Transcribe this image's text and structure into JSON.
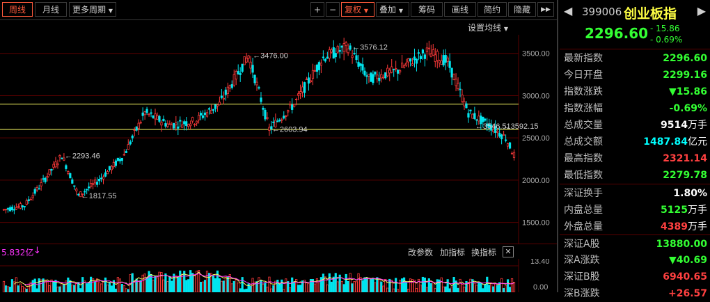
{
  "toolbar": {
    "period_week": "周线",
    "period_month": "月线",
    "period_more": "更多周期",
    "zoom_in": "+",
    "zoom_out": "−",
    "adjust": "复权",
    "overlay": "叠加",
    "chips": "筹码",
    "draw_line": "画线",
    "brief": "简约",
    "hide": "隐藏"
  },
  "chart_settings": {
    "ma_setting": "设置均线"
  },
  "chart_data": {
    "type": "candlestick",
    "y_ticks": [
      "3500.00",
      "3000.00",
      "2500.00",
      "2000.00",
      "1500.00"
    ],
    "ylim": [
      1250,
      3720
    ],
    "annotations": [
      "3476.00",
      "3576.12",
      "2603.94",
      "2293.46",
      "1817.55",
      "3546.51",
      "3592.15"
    ],
    "hlines": [
      2900,
      2600
    ]
  },
  "volume": {
    "label": "5.832亿",
    "arrow": "↓",
    "modify_params": "改参数",
    "add_indicator": "加指标",
    "switch_indicator": "换指标",
    "y_ticks": [
      "13.40",
      "0.00"
    ]
  },
  "panel": {
    "code": "399006",
    "name": "创业板指",
    "price": "2296.60",
    "change": "- 15.86",
    "change_pct": "- 0.69%",
    "rows": [
      {
        "label": "最新指数",
        "value": "2296.60",
        "color": "#33ff33",
        "unit": ""
      },
      {
        "label": "今日开盘",
        "value": "2299.16",
        "color": "#33ff33",
        "unit": ""
      },
      {
        "label": "指数涨跌",
        "value": "▼15.86",
        "color": "#33ff33",
        "unit": ""
      },
      {
        "label": "指数涨幅",
        "value": "-0.69%",
        "color": "#33ff33",
        "unit": ""
      },
      {
        "label": "总成交量",
        "value": "9514",
        "color": "#ffffff",
        "unit": "万手"
      },
      {
        "label": "总成交额",
        "value": "1487.84",
        "color": "#00ffff",
        "unit": "亿元"
      },
      {
        "label": "最高指数",
        "value": "2321.14",
        "color": "#ff4040",
        "unit": ""
      },
      {
        "label": "最低指数",
        "value": "2279.78",
        "color": "#33ff33",
        "unit": ""
      },
      {
        "label": "深证换手",
        "value": "1.80%",
        "color": "#ffffff",
        "unit": ""
      },
      {
        "label": "内盘总量",
        "value": "5125",
        "color": "#33ff33",
        "unit": "万手"
      },
      {
        "label": "外盘总量",
        "value": "4389",
        "color": "#ff4040",
        "unit": "万手"
      },
      {
        "label": "深证A股",
        "value": "13880.00",
        "color": "#33ff33",
        "unit": ""
      },
      {
        "label": "深A涨跌",
        "value": "▼40.69",
        "color": "#33ff33",
        "unit": ""
      },
      {
        "label": "深证B股",
        "value": "6940.65",
        "color": "#ff4040",
        "unit": ""
      },
      {
        "label": "深B涨跌",
        "value": "+26.57",
        "color": "#ff4040",
        "unit": ""
      }
    ]
  },
  "colors": {
    "up": "#ff3a3a",
    "down": "#00e5ee",
    "ma_yellow": "#ffff66",
    "ma_magenta": "#ff33ff",
    "grid": "#5a0000"
  }
}
